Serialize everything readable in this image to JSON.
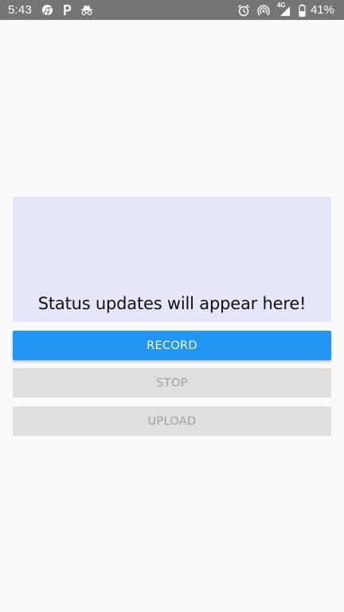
{
  "status_bar": {
    "time": "5:43",
    "left_icons": [
      "chrome-icon",
      "parking-icon",
      "incognito-icon"
    ],
    "right_icons": [
      "alarm-icon",
      "hotspot-icon",
      "signal-4g-icon",
      "battery-icon"
    ],
    "network_badge": "4G",
    "battery_percent": "41%"
  },
  "status_panel": {
    "message": "Status updates will appear here!"
  },
  "buttons": {
    "record": "RECORD",
    "stop": "STOP",
    "upload": "UPLOAD"
  },
  "colors": {
    "status_bar_bg": "#757575",
    "panel_bg": "#e6e6fa",
    "primary": "#2196f3",
    "disabled_bg": "#dfdfdf",
    "disabled_text": "#a1a1a1"
  }
}
